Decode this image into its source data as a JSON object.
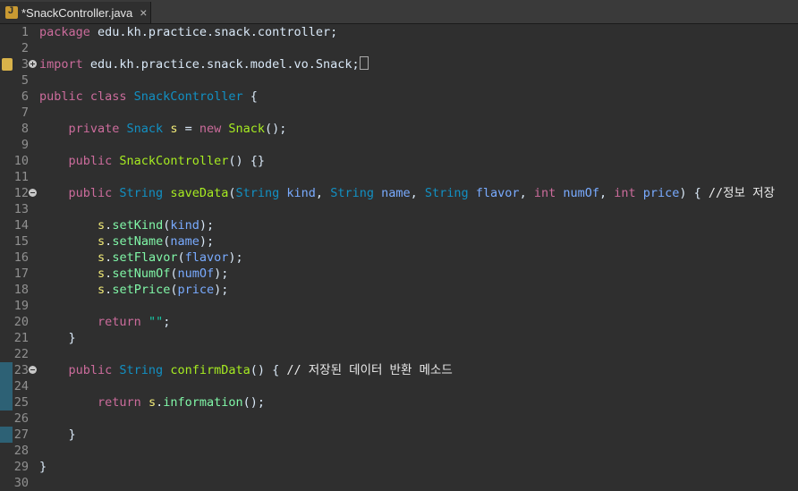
{
  "tab": {
    "title": "*SnackController.java",
    "close_icon": "×"
  },
  "lines": [
    {
      "n": "1",
      "fold": null,
      "marker": false,
      "changed": false,
      "segs": [
        [
          "kw",
          "package"
        ],
        [
          "plain",
          " edu.kh.practice.snack.controller;"
        ]
      ]
    },
    {
      "n": "2",
      "fold": null,
      "marker": false,
      "changed": false,
      "segs": []
    },
    {
      "n": "3",
      "fold": "plus",
      "marker": true,
      "changed": false,
      "segs": [
        [
          "kw",
          "import"
        ],
        [
          "plain",
          " edu.kh.practice.snack.model.vo.Snack;"
        ]
      ],
      "box": true
    },
    {
      "n": "5",
      "fold": null,
      "marker": false,
      "changed": false,
      "segs": []
    },
    {
      "n": "6",
      "fold": null,
      "marker": false,
      "changed": false,
      "segs": [
        [
          "kw",
          "public class "
        ],
        [
          "type",
          "SnackController"
        ],
        [
          "plain",
          " {"
        ]
      ]
    },
    {
      "n": "7",
      "fold": null,
      "marker": false,
      "changed": false,
      "segs": []
    },
    {
      "n": "8",
      "fold": null,
      "marker": false,
      "changed": false,
      "segs": [
        [
          "plain",
          "    "
        ],
        [
          "kw",
          "private "
        ],
        [
          "type",
          "Snack "
        ],
        [
          "id",
          "s"
        ],
        [
          "plain",
          " = "
        ],
        [
          "kw",
          "new "
        ],
        [
          "fn",
          "Snack"
        ],
        [
          "plain",
          "();"
        ]
      ]
    },
    {
      "n": "9",
      "fold": null,
      "marker": false,
      "changed": false,
      "segs": []
    },
    {
      "n": "10",
      "fold": null,
      "marker": false,
      "changed": false,
      "segs": [
        [
          "plain",
          "    "
        ],
        [
          "kw",
          "public "
        ],
        [
          "fn",
          "SnackController"
        ],
        [
          "plain",
          "() {}"
        ]
      ]
    },
    {
      "n": "11",
      "fold": null,
      "marker": false,
      "changed": false,
      "segs": []
    },
    {
      "n": "12",
      "fold": "minus",
      "marker": false,
      "changed": false,
      "segs": [
        [
          "plain",
          "    "
        ],
        [
          "kw",
          "public "
        ],
        [
          "type",
          "String "
        ],
        [
          "fn",
          "saveData"
        ],
        [
          "plain",
          "("
        ],
        [
          "type",
          "String "
        ],
        [
          "var",
          "kind"
        ],
        [
          "plain",
          ", "
        ],
        [
          "type",
          "String "
        ],
        [
          "var",
          "name"
        ],
        [
          "plain",
          ", "
        ],
        [
          "type",
          "String "
        ],
        [
          "var",
          "flavor"
        ],
        [
          "plain",
          ", "
        ],
        [
          "kw",
          "int "
        ],
        [
          "var",
          "numOf"
        ],
        [
          "plain",
          ", "
        ],
        [
          "kw",
          "int "
        ],
        [
          "var",
          "price"
        ],
        [
          "plain",
          ") { "
        ],
        [
          "cmt",
          "//정보 저장"
        ]
      ]
    },
    {
      "n": "13",
      "fold": null,
      "marker": false,
      "changed": false,
      "segs": []
    },
    {
      "n": "14",
      "fold": null,
      "marker": false,
      "changed": false,
      "segs": [
        [
          "plain",
          "        "
        ],
        [
          "id",
          "s"
        ],
        [
          "plain",
          "."
        ],
        [
          "call",
          "setKind"
        ],
        [
          "plain",
          "("
        ],
        [
          "var",
          "kind"
        ],
        [
          "plain",
          ");"
        ]
      ]
    },
    {
      "n": "15",
      "fold": null,
      "marker": false,
      "changed": false,
      "segs": [
        [
          "plain",
          "        "
        ],
        [
          "id",
          "s"
        ],
        [
          "plain",
          "."
        ],
        [
          "call",
          "setName"
        ],
        [
          "plain",
          "("
        ],
        [
          "var",
          "name"
        ],
        [
          "plain",
          ");"
        ]
      ]
    },
    {
      "n": "16",
      "fold": null,
      "marker": false,
      "changed": false,
      "segs": [
        [
          "plain",
          "        "
        ],
        [
          "id",
          "s"
        ],
        [
          "plain",
          "."
        ],
        [
          "call",
          "setFlavor"
        ],
        [
          "plain",
          "("
        ],
        [
          "var",
          "flavor"
        ],
        [
          "plain",
          ");"
        ]
      ]
    },
    {
      "n": "17",
      "fold": null,
      "marker": false,
      "changed": false,
      "segs": [
        [
          "plain",
          "        "
        ],
        [
          "id",
          "s"
        ],
        [
          "plain",
          "."
        ],
        [
          "call",
          "setNumOf"
        ],
        [
          "plain",
          "("
        ],
        [
          "var",
          "numOf"
        ],
        [
          "plain",
          ");"
        ]
      ]
    },
    {
      "n": "18",
      "fold": null,
      "marker": false,
      "changed": false,
      "segs": [
        [
          "plain",
          "        "
        ],
        [
          "id",
          "s"
        ],
        [
          "plain",
          "."
        ],
        [
          "call",
          "setPrice"
        ],
        [
          "plain",
          "("
        ],
        [
          "var",
          "price"
        ],
        [
          "plain",
          ");"
        ]
      ]
    },
    {
      "n": "19",
      "fold": null,
      "marker": false,
      "changed": false,
      "segs": []
    },
    {
      "n": "20",
      "fold": null,
      "marker": false,
      "changed": false,
      "segs": [
        [
          "plain",
          "        "
        ],
        [
          "kw",
          "return "
        ],
        [
          "str",
          "\"\""
        ],
        [
          "plain",
          ";"
        ]
      ]
    },
    {
      "n": "21",
      "fold": null,
      "marker": false,
      "changed": false,
      "segs": [
        [
          "plain",
          "    }"
        ]
      ]
    },
    {
      "n": "22",
      "fold": null,
      "marker": false,
      "changed": false,
      "segs": []
    },
    {
      "n": "23",
      "fold": "minus",
      "marker": false,
      "changed": true,
      "segs": [
        [
          "plain",
          "    "
        ],
        [
          "kw",
          "public "
        ],
        [
          "type",
          "String "
        ],
        [
          "fn",
          "confirmData"
        ],
        [
          "plain",
          "() { "
        ],
        [
          "cmt",
          "// 저장된 데이터 반환 메소드"
        ]
      ]
    },
    {
      "n": "24",
      "fold": null,
      "marker": false,
      "changed": true,
      "segs": []
    },
    {
      "n": "25",
      "fold": null,
      "marker": false,
      "changed": true,
      "segs": [
        [
          "plain",
          "        "
        ],
        [
          "kw",
          "return "
        ],
        [
          "id",
          "s"
        ],
        [
          "plain",
          "."
        ],
        [
          "call",
          "information"
        ],
        [
          "plain",
          "();"
        ]
      ]
    },
    {
      "n": "26",
      "fold": null,
      "marker": false,
      "changed": true,
      "current": true,
      "segs": []
    },
    {
      "n": "27",
      "fold": null,
      "marker": false,
      "changed": true,
      "segs": [
        [
          "plain",
          "    }"
        ]
      ]
    },
    {
      "n": "28",
      "fold": null,
      "marker": false,
      "changed": false,
      "segs": []
    },
    {
      "n": "29",
      "fold": null,
      "marker": false,
      "changed": false,
      "segs": [
        [
          "plain",
          "}"
        ]
      ]
    },
    {
      "n": "30",
      "fold": null,
      "marker": false,
      "changed": false,
      "segs": []
    }
  ]
}
